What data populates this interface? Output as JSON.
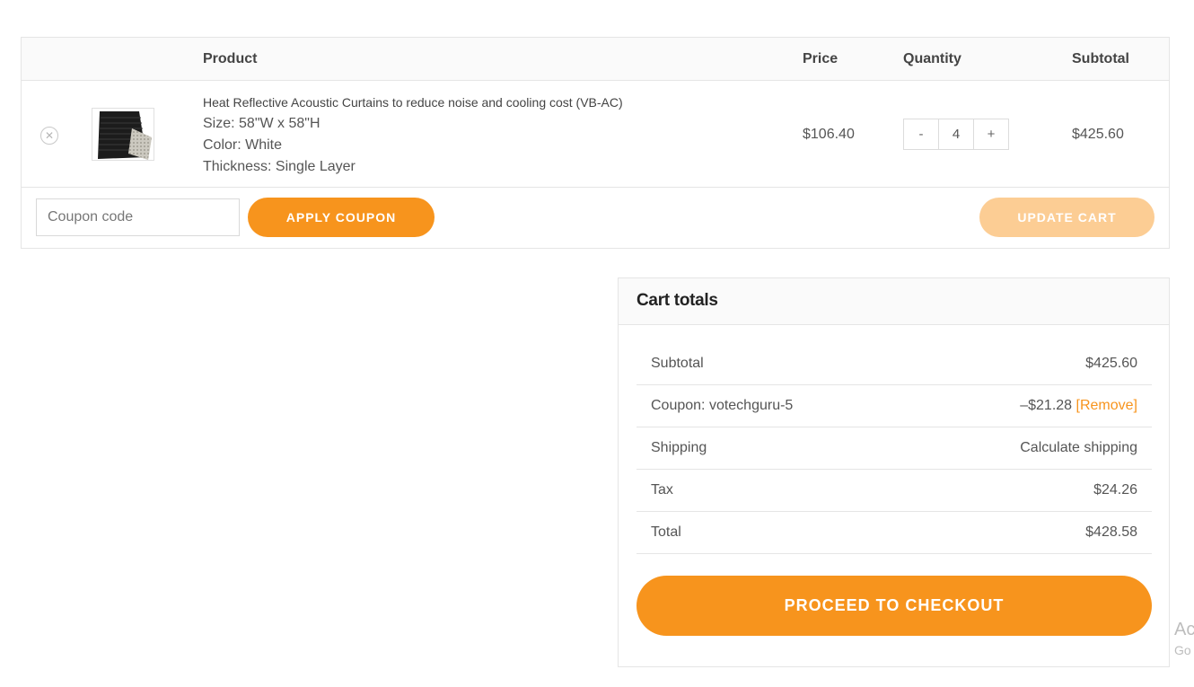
{
  "table": {
    "headers": {
      "product": "Product",
      "price": "Price",
      "quantity": "Quantity",
      "subtotal": "Subtotal"
    },
    "item": {
      "remove_icon": "close-circle-icon",
      "remove_glyph": "✕",
      "thumbnail_icon": "curtain-product-image",
      "name": "Heat Reflective Acoustic Curtains to reduce noise and cooling cost (VB-AC)",
      "size": "Size: 58\"W x 58\"H",
      "color": "Color: White",
      "thickness": "Thickness: Single Layer",
      "price": "$106.40",
      "quantity": "4",
      "qty_minus": "-",
      "qty_plus": "+",
      "subtotal": "$425.60"
    },
    "actions": {
      "coupon_placeholder": "Coupon code",
      "apply_label": "APPLY COUPON",
      "update_label": "UPDATE CART"
    }
  },
  "totals": {
    "title": "Cart totals",
    "rows": {
      "subtotal_label": "Subtotal",
      "subtotal_value": "$425.60",
      "coupon_label": "Coupon: votechguru-5",
      "coupon_value": "–$21.28",
      "coupon_remove": "[Remove]",
      "shipping_label": "Shipping",
      "shipping_value": "Calculate shipping",
      "tax_label": "Tax",
      "tax_value": "$24.26",
      "total_label": "Total",
      "total_value": "$428.58"
    },
    "checkout_label": "PROCEED TO CHECKOUT"
  },
  "watermark": {
    "line1": "Ac",
    "line2": "Go"
  },
  "colors": {
    "accent": "#f7941d",
    "accent_disabled": "#fccd94",
    "border": "#e5e5e5",
    "header_bg": "#fafafa"
  }
}
